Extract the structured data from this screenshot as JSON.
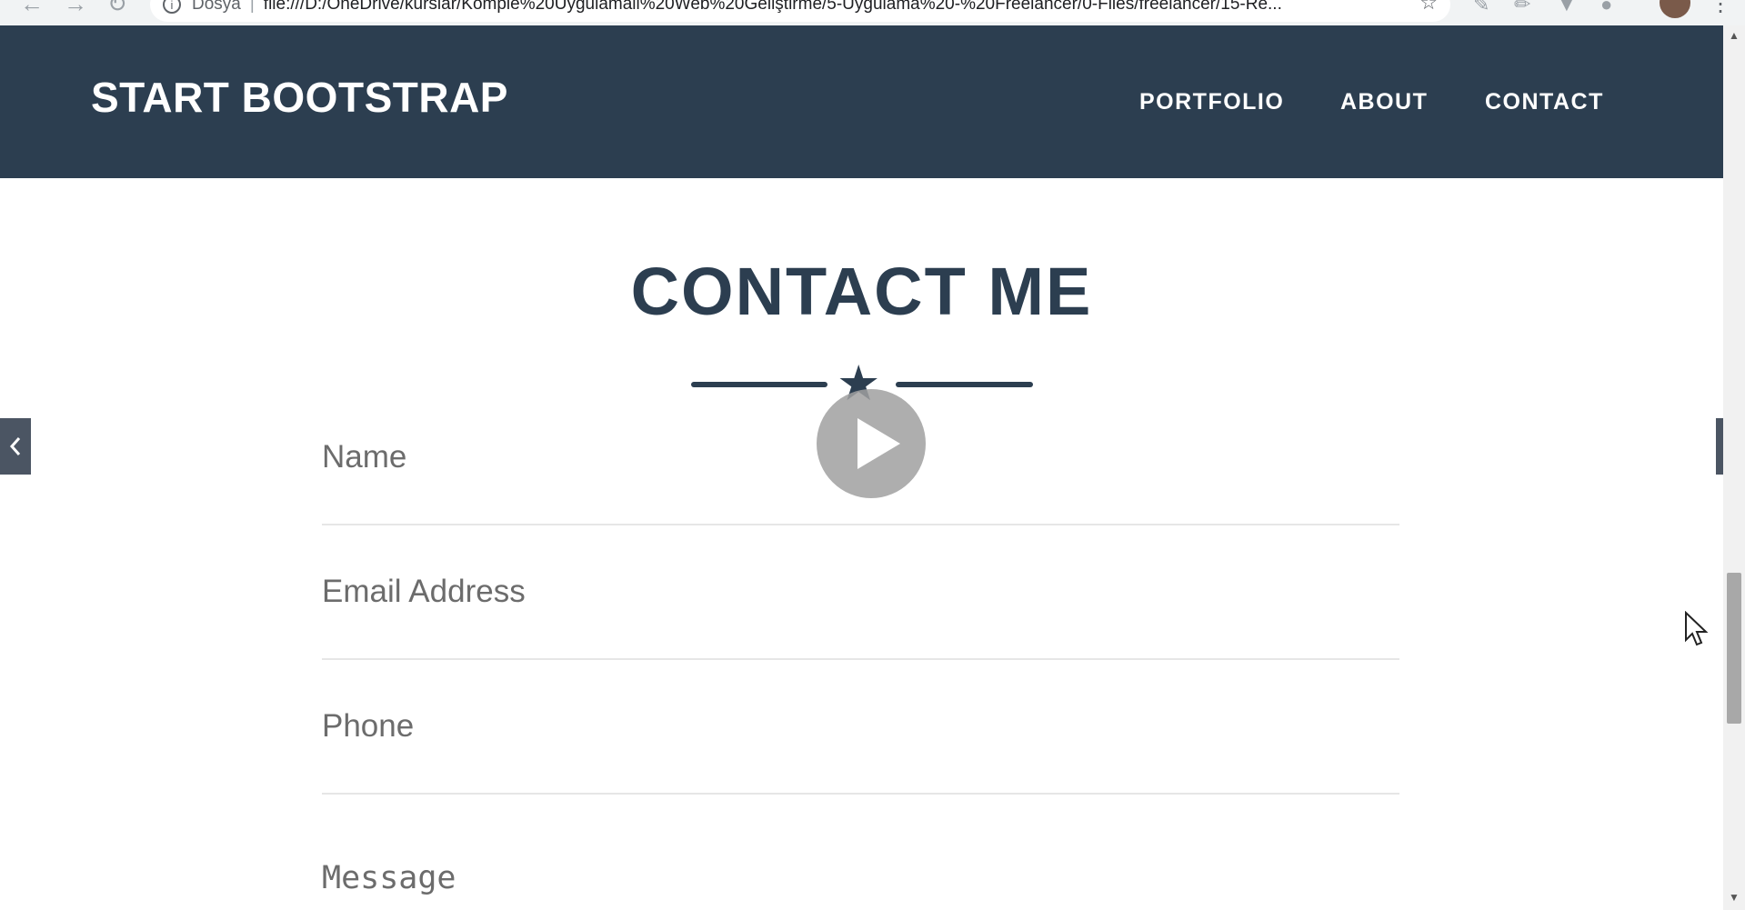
{
  "browser": {
    "scheme_label": "Dosya",
    "url": "file:///D:/OneDrive/kurslar/Komple%20Uygulamali%20Web%20Geliştirme/5-Uygulama%20-%20Freelancer/0-Files/freelancer/15-Re..."
  },
  "navbar": {
    "brand": "START BOOTSTRAP",
    "links": [
      "PORTFOLIO",
      "ABOUT",
      "CONTACT"
    ]
  },
  "contact": {
    "title": "CONTACT ME",
    "fields": {
      "name_placeholder": "Name",
      "email_placeholder": "Email Address",
      "phone_placeholder": "Phone",
      "message_placeholder": "Message"
    }
  },
  "colors": {
    "primary": "#2c3e50",
    "field_border": "#e6e6e6"
  },
  "icons": [
    "star-icon",
    "play-icon",
    "chevron-left-icon",
    "chevron-right-icon",
    "mouse-cursor-icon"
  ]
}
